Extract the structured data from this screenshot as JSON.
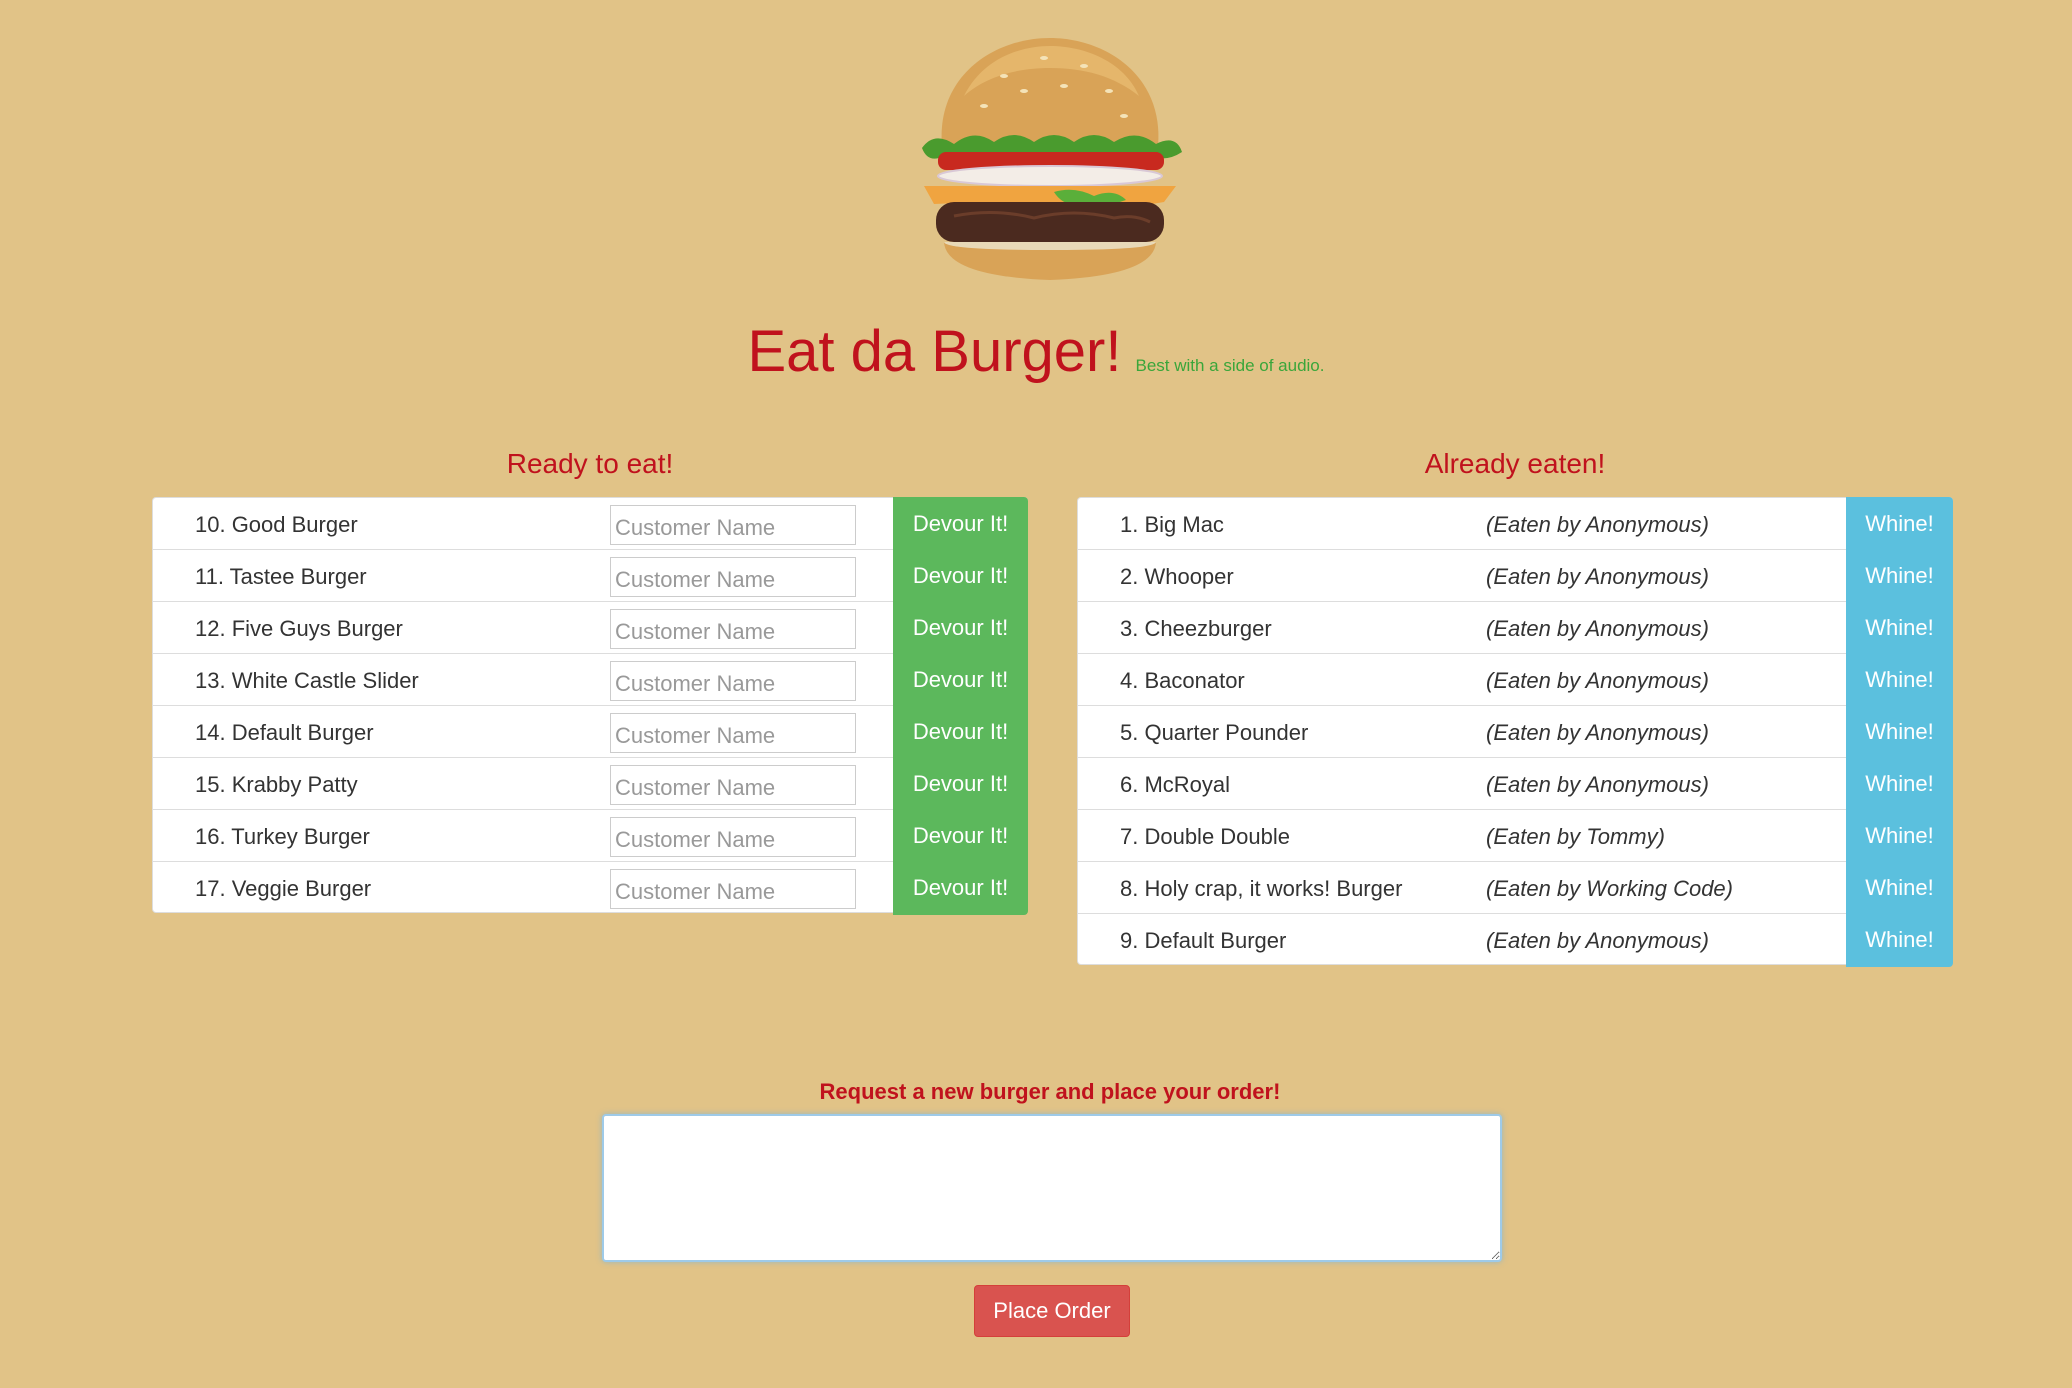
{
  "header": {
    "title": "Eat da Burger!",
    "subtitle": "Best with a side of audio."
  },
  "ready": {
    "heading": "Ready to eat!",
    "input_placeholder": "Customer Name",
    "button_label": "Devour It!",
    "items": [
      {
        "label": "10. Good Burger"
      },
      {
        "label": "11. Tastee Burger"
      },
      {
        "label": "12. Five Guys Burger"
      },
      {
        "label": "13. White Castle Slider"
      },
      {
        "label": "14. Default Burger"
      },
      {
        "label": "15. Krabby Patty"
      },
      {
        "label": "16. Turkey Burger"
      },
      {
        "label": "17. Veggie Burger"
      }
    ]
  },
  "eaten": {
    "heading": "Already eaten!",
    "button_label": "Whine!",
    "items": [
      {
        "label": "1. Big Mac",
        "eaten_by": "(Eaten by Anonymous)"
      },
      {
        "label": "2. Whooper",
        "eaten_by": "(Eaten by Anonymous)"
      },
      {
        "label": "3. Cheezburger",
        "eaten_by": "(Eaten by Anonymous)"
      },
      {
        "label": "4. Baconator",
        "eaten_by": "(Eaten by Anonymous)"
      },
      {
        "label": "5. Quarter Pounder",
        "eaten_by": "(Eaten by Anonymous)"
      },
      {
        "label": "6. McRoyal",
        "eaten_by": "(Eaten by Anonymous)"
      },
      {
        "label": "7. Double Double",
        "eaten_by": "(Eaten by Tommy)"
      },
      {
        "label": "8. Holy crap, it works! Burger",
        "eaten_by": "(Eaten by Working Code)"
      },
      {
        "label": "9. Default Burger",
        "eaten_by": "(Eaten by Anonymous)"
      }
    ]
  },
  "order": {
    "label": "Request a new burger and place your order!",
    "textarea_value": "",
    "button_label": "Place Order"
  },
  "colors": {
    "background": "#e1c387",
    "title_red": "#c0121d",
    "subtitle_green": "#3aa63a",
    "devour_green": "#5cb85c",
    "whine_blue": "#5bc0de",
    "order_red": "#d9534f"
  },
  "icons": {
    "logo": "burger-image"
  }
}
